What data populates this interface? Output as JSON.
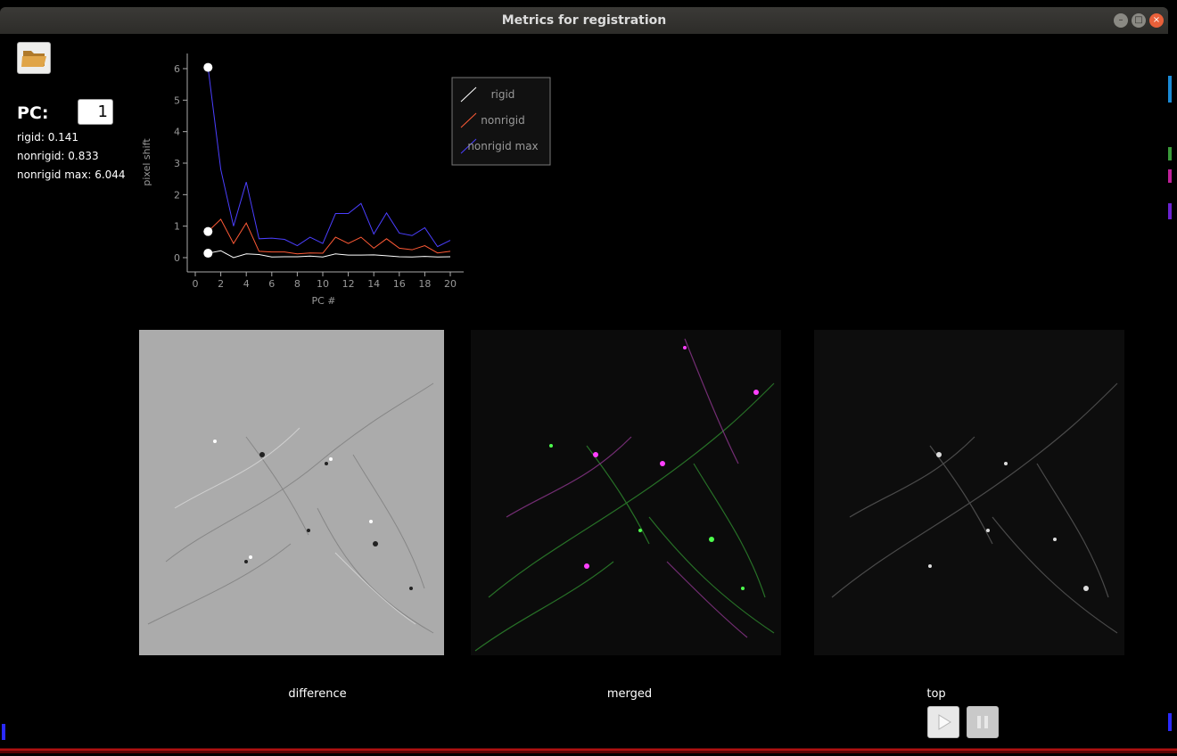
{
  "window": {
    "title": "Metrics for registration",
    "minimize": "–",
    "maximize": "□",
    "close": "×"
  },
  "controls": {
    "pc_label": "PC:",
    "pc_value": "1",
    "folder_icon": "folder-open-icon"
  },
  "metrics": {
    "rigid": "rigid: 0.141",
    "nonrigid": "nonrigid: 0.833",
    "nonrigid_max": "nonrigid max: 6.044"
  },
  "chart_data": {
    "type": "line",
    "xlabel": "PC #",
    "ylabel": "pixel shift",
    "xlim": [
      0,
      20
    ],
    "ylim": [
      0,
      6
    ],
    "xticks": [
      "0",
      "2",
      "4",
      "6",
      "8",
      "10",
      "12",
      "14",
      "16",
      "18",
      "20"
    ],
    "yticks": [
      "0",
      "1",
      "2",
      "3",
      "4",
      "5",
      "6"
    ],
    "legend_position": "top-right",
    "x": [
      1,
      2,
      3,
      4,
      5,
      6,
      7,
      8,
      9,
      10,
      11,
      12,
      13,
      14,
      15,
      16,
      17,
      18,
      19,
      20
    ],
    "series": [
      {
        "name": "rigid",
        "color": "#ffffff",
        "values": [
          0.14,
          0.22,
          0.0,
          0.12,
          0.1,
          0.02,
          0.03,
          0.03,
          0.05,
          0.02,
          0.12,
          0.08,
          0.08,
          0.09,
          0.06,
          0.03,
          0.02,
          0.04,
          0.02,
          0.03
        ]
      },
      {
        "name": "nonrigid",
        "color": "#ff5a36",
        "values": [
          0.83,
          1.22,
          0.45,
          1.1,
          0.2,
          0.18,
          0.18,
          0.12,
          0.15,
          0.14,
          0.65,
          0.45,
          0.65,
          0.3,
          0.6,
          0.3,
          0.25,
          0.38,
          0.15,
          0.2
        ]
      },
      {
        "name": "nonrigid max",
        "color": "#4b3fff",
        "values": [
          6.04,
          2.8,
          1.0,
          2.4,
          0.6,
          0.62,
          0.58,
          0.38,
          0.65,
          0.45,
          1.4,
          1.4,
          1.72,
          0.75,
          1.42,
          0.78,
          0.7,
          0.95,
          0.35,
          0.55
        ]
      }
    ],
    "highlight_x": 1
  },
  "panels": [
    {
      "caption": "difference"
    },
    {
      "caption": "merged"
    },
    {
      "caption": "top"
    }
  ],
  "movie_controls": {
    "play_icon": "play-icon",
    "pause_icon": "pause-icon"
  }
}
